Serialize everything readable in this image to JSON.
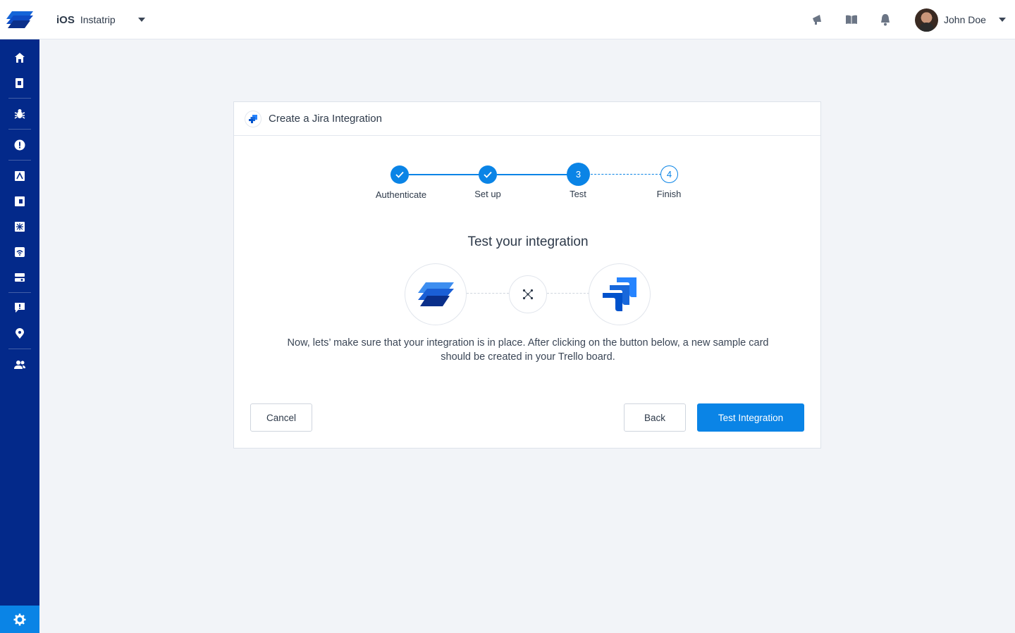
{
  "app": {
    "platform": "iOS",
    "name": "Instatrip"
  },
  "user": {
    "name": "John Doe"
  },
  "topbar_icons": [
    "announcement-icon",
    "docs-book-icon",
    "notifications-bell-icon"
  ],
  "sidebar": {
    "items": [
      {
        "icon": "home-icon"
      },
      {
        "icon": "reports-icon"
      },
      {
        "icon": "bug-icon"
      },
      {
        "icon": "crash-icon"
      },
      {
        "icon": "sessions-icon"
      },
      {
        "icon": "surveys-icon"
      },
      {
        "icon": "features-icon"
      },
      {
        "icon": "network-icon"
      },
      {
        "icon": "settings-panel-icon"
      },
      {
        "icon": "chat-icon"
      },
      {
        "icon": "location-icon"
      },
      {
        "icon": "team-icon"
      }
    ],
    "bottom_icon": "gear-icon"
  },
  "card": {
    "title": "Create a Jira Integration",
    "steps": [
      {
        "label": "Authenticate",
        "state": "done"
      },
      {
        "label": "Set up",
        "state": "done"
      },
      {
        "label": "Test",
        "number": "3",
        "state": "active"
      },
      {
        "label": "Finish",
        "number": "4",
        "state": "todo"
      }
    ],
    "section_title": "Test your integration",
    "description": "Now, lets’ make sure that your integration is in place. After clicking on the button below, a new sample card should be created in your Trello board.",
    "cancel_label": "Cancel",
    "back_label": "Back",
    "test_label": "Test Integration"
  },
  "colors": {
    "accent": "#0a84e6",
    "sidebar": "#03298a",
    "background": "#f2f4f8"
  }
}
